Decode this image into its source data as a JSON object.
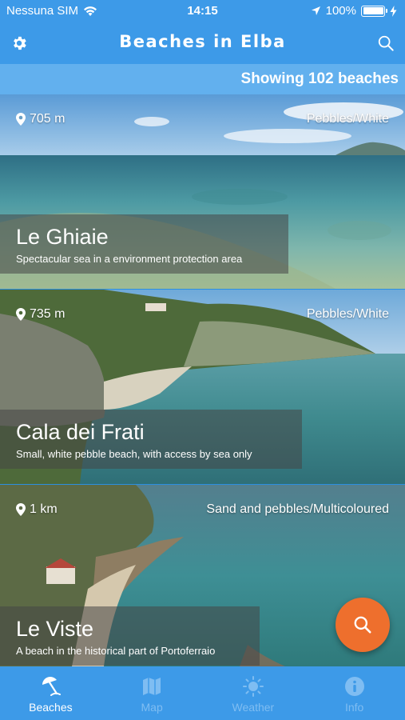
{
  "status": {
    "carrier": "Nessuna SIM",
    "time": "14:15",
    "battery": "100%",
    "battery_level": 1.0
  },
  "nav": {
    "title": "Beaches in Elba",
    "left_icon": "gear-icon",
    "right_icon": "search-icon"
  },
  "results": {
    "text": "Showing 102 beaches"
  },
  "beaches": [
    {
      "name": "Le Ghiaie",
      "description": "Spectacular sea in a environment protection area",
      "distance": "705 m",
      "type": "Pebbles/White"
    },
    {
      "name": "Cala dei Frati",
      "description": "Small, white pebble beach, with access by sea only",
      "distance": "735 m",
      "type": "Pebbles/White"
    },
    {
      "name": "Le Viste",
      "description": "A beach in the historical part of Portoferraio",
      "distance": "1 km",
      "type": "Sand and pebbles/Multicoloured"
    }
  ],
  "tabs": [
    {
      "label": "Beaches",
      "icon": "beach-umbrella-icon",
      "active": true
    },
    {
      "label": "Map",
      "icon": "map-icon",
      "active": false
    },
    {
      "label": "Weather",
      "icon": "sun-icon",
      "active": false
    },
    {
      "label": "Info",
      "icon": "info-icon",
      "active": false
    }
  ],
  "colors": {
    "primary": "#3d9ae8",
    "count_bar": "#62b0ee",
    "fab": "#ee6f2d",
    "tab_inactive": "#7fbdf2"
  }
}
